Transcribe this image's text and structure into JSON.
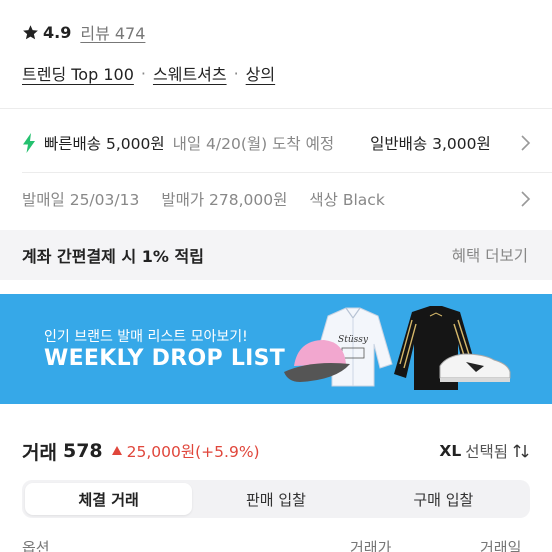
{
  "product": {
    "rating": "4.9",
    "review_count_text": "리뷰 474",
    "categories": [
      "트렌딩 Top 100",
      "스웨트셔츠",
      "상의"
    ],
    "category_separator": "·"
  },
  "shipping": {
    "fast": "빠른배송 5,000원",
    "fast_eta": "내일 4/20(월) 도착 예정",
    "normal": "일반배송 3,000원"
  },
  "release": {
    "date": "발매일 25/03/13",
    "price": "발매가 278,000원",
    "color": "색상 Black"
  },
  "benefit": {
    "text": "계좌 간편결제 시 1% 적립",
    "more": "혜택 더보기"
  },
  "banner": {
    "subtitle": "인기 브랜드 발매 리스트 모아보기!",
    "headline": "WEEKLY DROP LIST",
    "color": "#36a8e8"
  },
  "trades": {
    "label": "거래",
    "count": "578",
    "change": "25,000원(+5.9%)",
    "change_color": "#e0463b",
    "size_value": "XL",
    "size_label": "선택됨",
    "tabs": [
      "체결 거래",
      "판매 입찰",
      "구매 입찰"
    ],
    "active_tab": 0,
    "columns": [
      "옵션",
      "거래가",
      "거래일"
    ]
  }
}
